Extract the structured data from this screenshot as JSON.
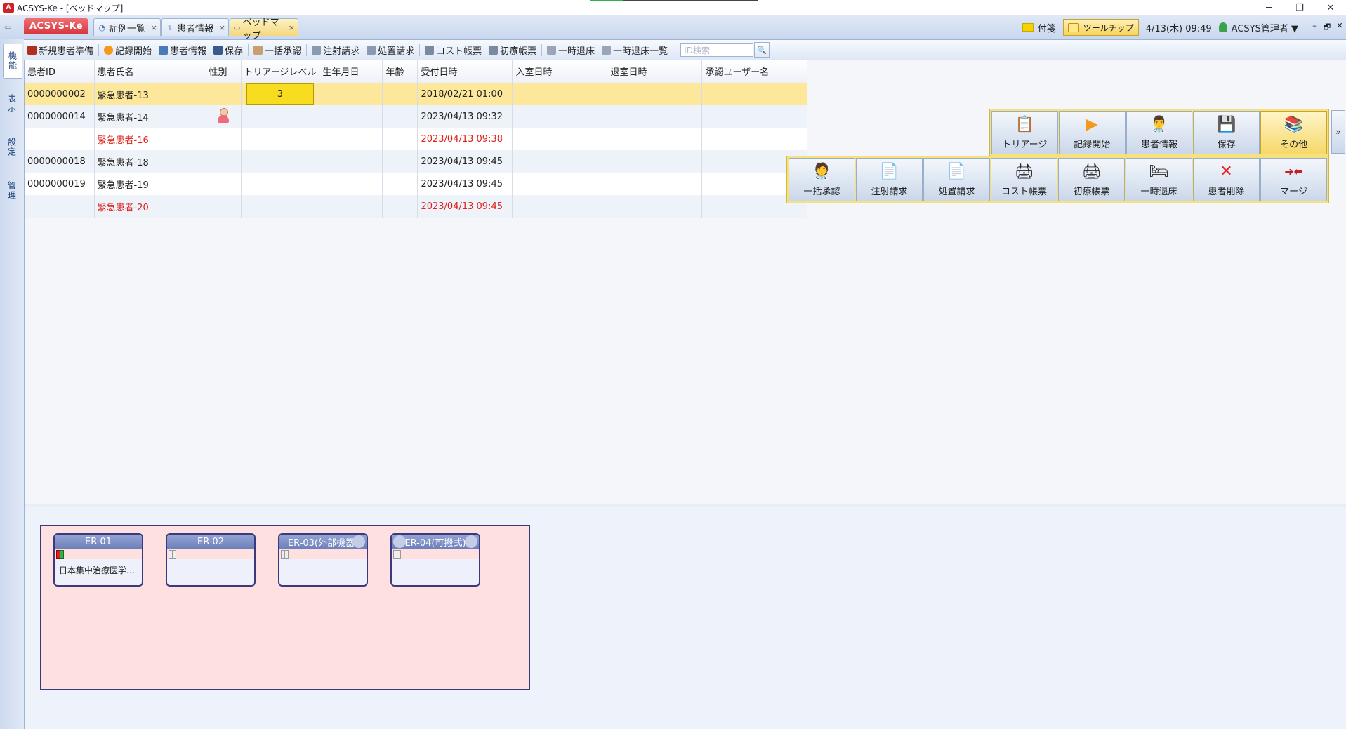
{
  "window": {
    "title": "ACSYS-Ke - [ベッドマップ]",
    "logo_text": "A",
    "minimize": "─",
    "restore": "❐",
    "close": "✕"
  },
  "tabs": {
    "brand": "ACSYS-Ke",
    "items": [
      {
        "label": "症例一覧",
        "icon": "case-list-icon"
      },
      {
        "label": "患者情報",
        "icon": "patient-icon"
      },
      {
        "label": "ベッドマップ",
        "icon": "bed-icon"
      }
    ],
    "close_glyph": "×"
  },
  "status": {
    "memo_label": "付箋",
    "tooltip_label": "ツールチップ",
    "datetime": "4/13(木) 09:49",
    "user": "ACSYS管理者 ▼",
    "mini_minimize": "–",
    "mini_restore": "🗗",
    "mini_close": "✕"
  },
  "sidebar": {
    "items": [
      {
        "label": "機能",
        "active": true
      },
      {
        "label": "表示",
        "active": false
      },
      {
        "label": "設定",
        "active": false
      },
      {
        "label": "管理",
        "active": false
      }
    ]
  },
  "toolbar": {
    "items": [
      {
        "label": "新規患者準備",
        "color": "#b03020"
      },
      {
        "label": "記録開始",
        "color": "#f39a1d"
      },
      {
        "label": "患者情報",
        "color": "#4a7ab8"
      },
      {
        "label": "保存",
        "color": "#3a5a8a"
      },
      {
        "label": "一括承認",
        "color": "#c8a070"
      },
      {
        "label": "注射請求",
        "color": "#8a9ab0"
      },
      {
        "label": "処置請求",
        "color": "#8a9ab0"
      },
      {
        "label": "コスト帳票",
        "color": "#7a8aa0"
      },
      {
        "label": "初療帳票",
        "color": "#7a8aa0"
      },
      {
        "label": "一時退床",
        "color": "#9aa6b8"
      },
      {
        "label": "一時退床一覧",
        "color": "#9aa6b8"
      }
    ],
    "search_placeholder": "ID検索",
    "search_icon": "🔍"
  },
  "grid": {
    "columns": [
      "患者ID",
      "患者氏名",
      "性別",
      "トリアージレベル",
      "生年月日",
      "年齢",
      "受付日時",
      "入室日時",
      "退室日時",
      "承認ユーザー名"
    ],
    "rows": [
      {
        "id": "0000000002",
        "name": "緊急患者-13",
        "sex": "",
        "triage": "3",
        "birth": "",
        "age": "",
        "received": "2018/02/21 01:00",
        "in": "",
        "out": "",
        "approver": "",
        "selected": true,
        "red": false
      },
      {
        "id": "0000000014",
        "name": "緊急患者-14",
        "sex": "female",
        "triage": "",
        "birth": "",
        "age": "",
        "received": "2023/04/13 09:32",
        "in": "",
        "out": "",
        "approver": "",
        "selected": false,
        "red": false
      },
      {
        "id": "",
        "name": "緊急患者-16",
        "sex": "",
        "triage": "",
        "birth": "",
        "age": "",
        "received": "2023/04/13 09:38",
        "in": "",
        "out": "",
        "approver": "",
        "selected": false,
        "red": true
      },
      {
        "id": "0000000018",
        "name": "緊急患者-18",
        "sex": "",
        "triage": "",
        "birth": "",
        "age": "",
        "received": "2023/04/13 09:45",
        "in": "",
        "out": "",
        "approver": "",
        "selected": false,
        "red": false
      },
      {
        "id": "0000000019",
        "name": "緊急患者-19",
        "sex": "",
        "triage": "",
        "birth": "",
        "age": "",
        "received": "2023/04/13 09:45",
        "in": "",
        "out": "",
        "approver": "",
        "selected": false,
        "red": false
      },
      {
        "id": "",
        "name": "緊急患者-20",
        "sex": "",
        "triage": "",
        "birth": "",
        "age": "",
        "received": "2023/04/13 09:45",
        "in": "",
        "out": "",
        "approver": "",
        "selected": false,
        "red": true
      }
    ]
  },
  "actions": {
    "top": [
      {
        "label": "トリアージ",
        "icon": "triage-icon",
        "glyph": "📋"
      },
      {
        "label": "記録開始",
        "icon": "record-start-icon",
        "glyph": "▶"
      },
      {
        "label": "患者情報",
        "icon": "patient-info-icon",
        "glyph": "👨‍⚕️"
      },
      {
        "label": "保存",
        "icon": "save-icon",
        "glyph": "💾"
      },
      {
        "label": "その他",
        "icon": "other-icon",
        "glyph": "📚"
      }
    ],
    "bottom": [
      {
        "label": "一括承認",
        "icon": "bulk-approve-icon",
        "glyph": "🧑‍⚕️"
      },
      {
        "label": "注射請求",
        "icon": "injection-request-icon",
        "glyph": "📄"
      },
      {
        "label": "処置請求",
        "icon": "treatment-request-icon",
        "glyph": "📄"
      },
      {
        "label": "コスト帳票",
        "icon": "cost-report-icon",
        "glyph": "🖨"
      },
      {
        "label": "初療帳票",
        "icon": "initial-report-icon",
        "glyph": "🖨"
      },
      {
        "label": "一時退床",
        "icon": "temporary-leave-icon",
        "glyph": "🛏"
      },
      {
        "label": "患者削除",
        "icon": "delete-patient-icon",
        "glyph": "✕"
      },
      {
        "label": "マージ",
        "icon": "merge-icon",
        "glyph": "➜⬅"
      }
    ],
    "more": "»"
  },
  "bedmap": {
    "beds": [
      {
        "label": "ER-01",
        "patient": "日本集中治療医学…",
        "occupied": true
      },
      {
        "label": "ER-02",
        "patient": "",
        "occupied": false
      },
      {
        "label": "ER-03(外部機器)",
        "patient": "",
        "occupied": false
      },
      {
        "label": "ER-04(可搬式)",
        "patient": "",
        "occupied": false
      }
    ]
  }
}
